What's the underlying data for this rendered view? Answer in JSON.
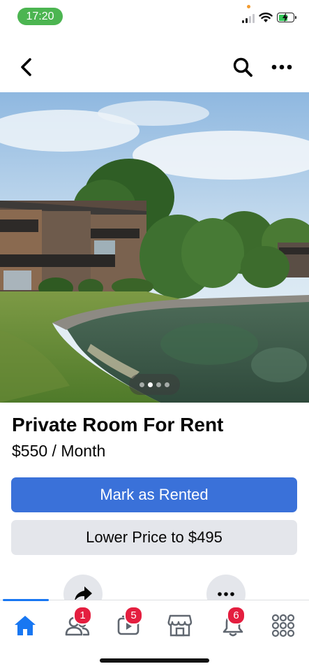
{
  "status_bar": {
    "time": "17:20"
  },
  "header": {
    "back_icon": "chevron-left-icon",
    "search_icon": "search-icon",
    "more_icon": "more-horizontal-icon"
  },
  "photo": {
    "description_icon": "listing-photo",
    "carousel": {
      "count": 4,
      "active_index": 1
    }
  },
  "listing": {
    "title": "Private Room For Rent",
    "price": "$550 / Month"
  },
  "actions": {
    "primary_label": "Mark as Rented",
    "secondary_label": "Lower Price to $495",
    "share_icon": "share-icon",
    "more_icon": "more-horizontal-icon"
  },
  "tab_bar": {
    "tabs": [
      {
        "name": "home",
        "icon": "home-icon",
        "active": true
      },
      {
        "name": "friends",
        "icon": "friends-icon",
        "badge": "1"
      },
      {
        "name": "watch",
        "icon": "watch-icon",
        "badge": "5"
      },
      {
        "name": "marketplace",
        "icon": "marketplace-icon"
      },
      {
        "name": "notifications",
        "icon": "bell-icon",
        "badge": "6"
      },
      {
        "name": "menu",
        "icon": "grid-menu-icon"
      }
    ]
  },
  "colors": {
    "primary": "#3a71d9",
    "secondary": "#e4e6eb",
    "badge": "#e41e3f",
    "active_tab": "#1877f2",
    "time_pill": "#4cb551"
  }
}
